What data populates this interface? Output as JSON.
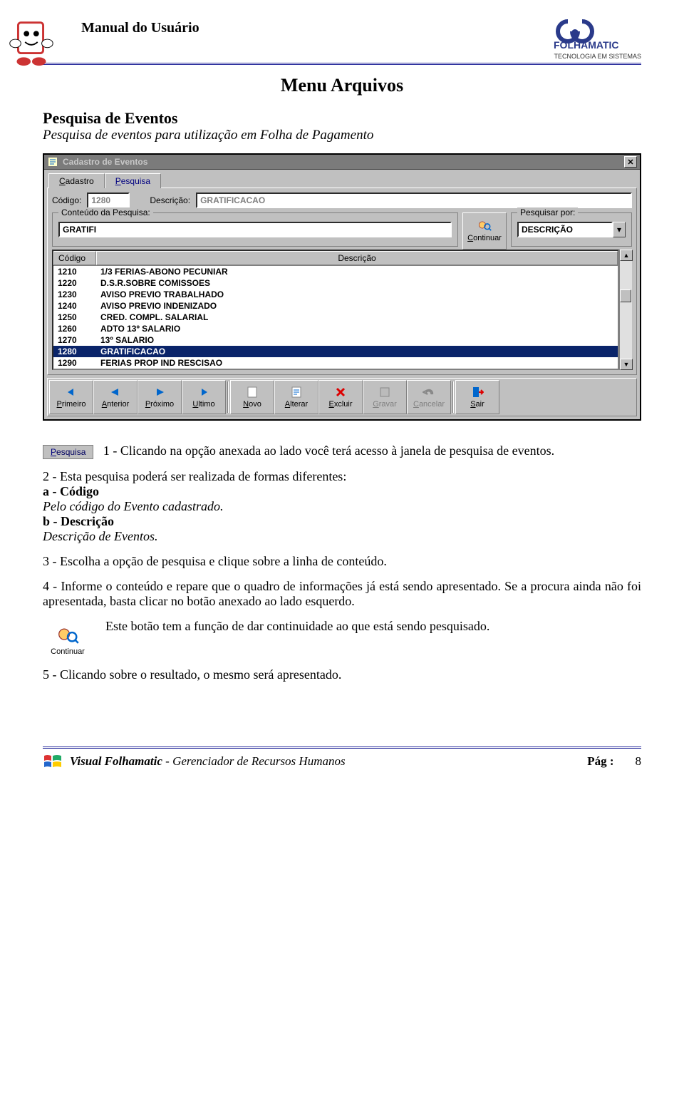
{
  "doc": {
    "header_title": "Manual do Usuário",
    "logo_name": "FOLHAMATIC",
    "logo_tagline": "TECNOLOGIA EM SISTEMAS",
    "menu_title": "Menu Arquivos",
    "section_title": "Pesquisa de Eventos",
    "section_sub": "Pesquisa de eventos para utilização em Folha de Pagamento"
  },
  "window": {
    "title": "Cadastro de Eventos",
    "tabs": {
      "cadastro": "Cadastro",
      "pesquisa": "Pesquisa"
    },
    "codigo_label": "Código:",
    "codigo_value": "1280",
    "descricao_label": "Descrição:",
    "descricao_value": "GRATIFICACAO",
    "conteudo_legend": "Conteúdo da Pesquisa:",
    "conteudo_value": "GRATIFI",
    "continuar_label": "Continuar",
    "pesquisar_legend": "Pesquisar por:",
    "pesquisar_value": "DESCRIÇÃO",
    "grid_headers": {
      "codigo": "Código",
      "descricao": "Descrição"
    },
    "rows": [
      {
        "c": "1210",
        "d": "1/3 FERIAS-ABONO PECUNIAR"
      },
      {
        "c": "1220",
        "d": "D.S.R.SOBRE COMISSOES"
      },
      {
        "c": "1230",
        "d": "AVISO PREVIO TRABALHADO"
      },
      {
        "c": "1240",
        "d": "AVISO PREVIO INDENIZADO"
      },
      {
        "c": "1250",
        "d": "CRED. COMPL. SALARIAL"
      },
      {
        "c": "1260",
        "d": "ADTO 13º SALARIO"
      },
      {
        "c": "1270",
        "d": "13º SALARIO"
      },
      {
        "c": "1280",
        "d": "GRATIFICACAO"
      },
      {
        "c": "1290",
        "d": "FERIAS PROP IND RESCISAO"
      }
    ],
    "selected_code": "1280",
    "toolbar": [
      {
        "name": "primeiro",
        "label": "Primeiro",
        "icon": "first",
        "disabled": false
      },
      {
        "name": "anterior",
        "label": "Anterior",
        "icon": "prev",
        "disabled": false
      },
      {
        "name": "proximo",
        "label": "Próximo",
        "icon": "next",
        "disabled": false
      },
      {
        "name": "ultimo",
        "label": "Ultimo",
        "icon": "last",
        "disabled": false
      },
      {
        "name": "novo",
        "label": "Novo",
        "icon": "new",
        "disabled": false
      },
      {
        "name": "alterar",
        "label": "Alterar",
        "icon": "edit",
        "disabled": false
      },
      {
        "name": "excluir",
        "label": "Excluir",
        "icon": "delete",
        "disabled": false
      },
      {
        "name": "gravar",
        "label": "Gravar",
        "icon": "save",
        "disabled": true
      },
      {
        "name": "cancelar",
        "label": "Cancelar",
        "icon": "undo",
        "disabled": true
      },
      {
        "name": "sair",
        "label": "Sair",
        "icon": "exit",
        "disabled": false
      }
    ]
  },
  "body": {
    "pesquisa_chip": "Pesquisa",
    "p1a": "1 - Clicando na opção anexada ao lado você terá acesso à janela de pesquisa de eventos.",
    "p2a": "2 - Esta pesquisa poderá ser realizada de formas diferentes:",
    "a_label": "a - Código",
    "a_desc": "Pelo código do Evento cadastrado.",
    "b_label": "b - Descrição",
    "b_desc": "Descrição de Eventos.",
    "p3": "3 - Escolha a opção de pesquisa e clique sobre a linha de conteúdo.",
    "p4": "4 - Informe o conteúdo e repare que o quadro de informações já está sendo apresentado. Se a procura ainda não foi apresentada, basta clicar no botão anexado ao lado esquerdo.",
    "cont_label": "Continuar",
    "cont_text": "Este botão tem a função de dar continuidade ao que está sendo pesquisado.",
    "p5": "5 - Clicando sobre o resultado, o mesmo será apresentado."
  },
  "footer": {
    "product_bold": "Visual Folhamatic",
    "product_rest": " - Gerenciador de Recursos Humanos",
    "page_label": "Pág :",
    "page_num": "8"
  }
}
